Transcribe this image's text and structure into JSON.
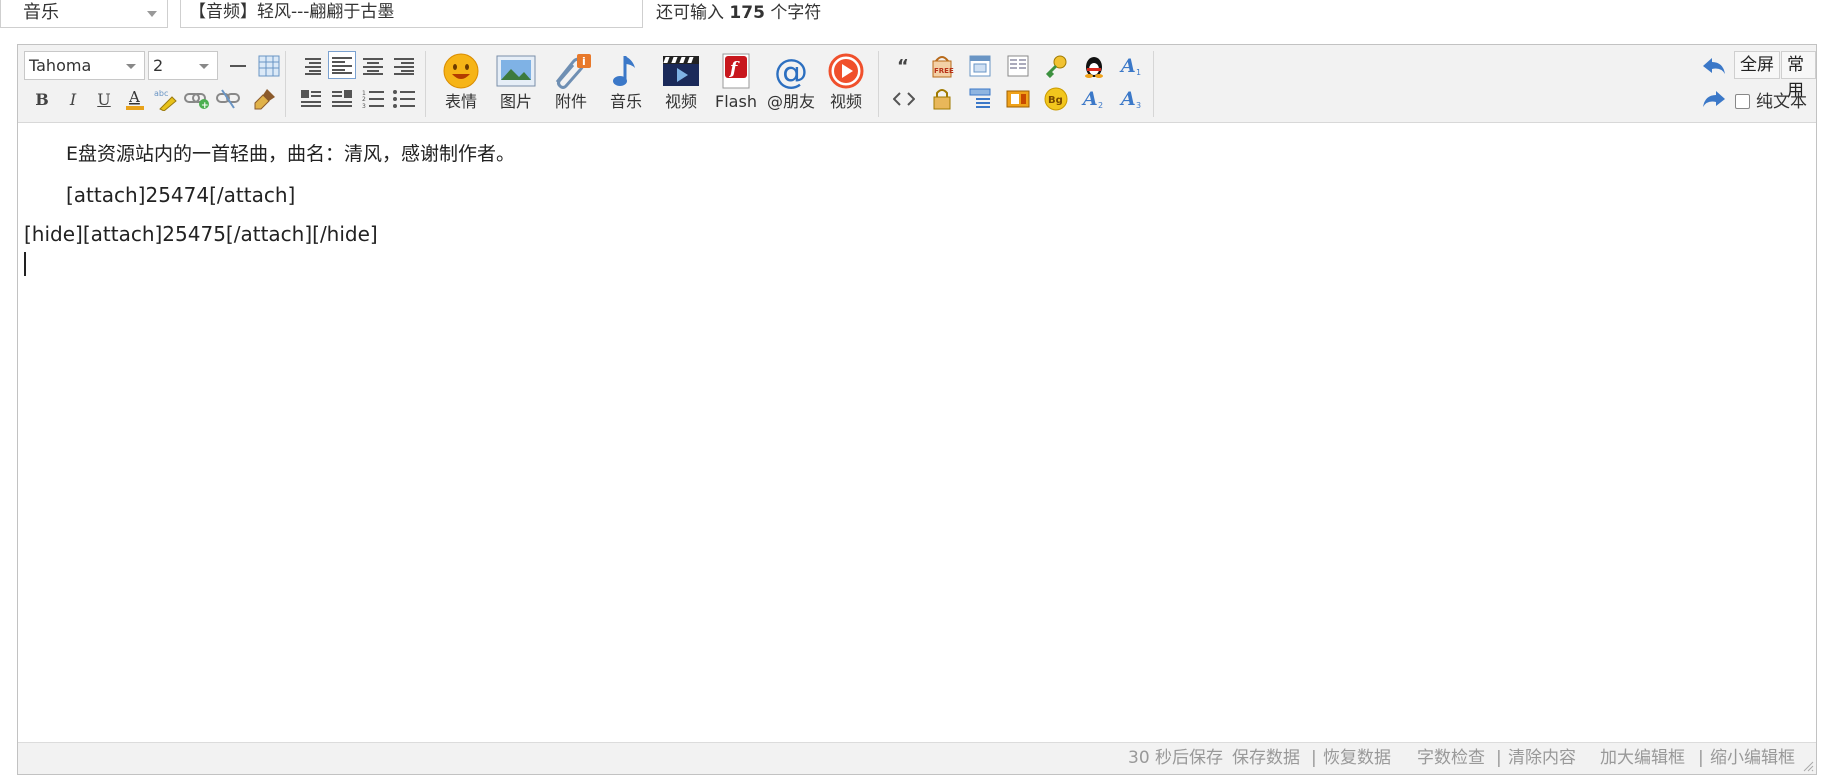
{
  "top": {
    "category_value": "音乐",
    "title_value": "【音频】轻风---翩翩于古墨",
    "remaining_prefix": "还可输入",
    "remaining_count": "175",
    "remaining_suffix": "个字符"
  },
  "toolbar": {
    "font_family": "Tahoma",
    "font_size": "2",
    "bold_label": "B",
    "italic_label": "I",
    "underline_label": "U",
    "font_color_label": "A",
    "big_buttons": [
      {
        "label": "表情",
        "icon": "smiley-icon"
      },
      {
        "label": "图片",
        "icon": "image-icon"
      },
      {
        "label": "附件",
        "icon": "attachment-icon"
      },
      {
        "label": "音乐",
        "icon": "music-icon"
      },
      {
        "label": "视频",
        "icon": "video-clapper-icon"
      },
      {
        "label": "Flash",
        "icon": "flash-icon"
      },
      {
        "label": "@朋友",
        "icon": "at-icon"
      },
      {
        "label": "视频",
        "icon": "play-circle-icon"
      }
    ],
    "fullscreen_label": "全屏",
    "common_label": "常用",
    "plain_text_label": "纯文本"
  },
  "content": {
    "line1": "E盘资源站内的一首轻曲，曲名：清风，感谢制作者。",
    "line2": "[attach]25474[/attach]",
    "line3": "[hide][attach]25475[/attach][/hide]"
  },
  "footer": {
    "autosave": "30 秒后保存",
    "save_data": "保存数据",
    "sep1": "|",
    "restore_data": "恢复数据",
    "word_check": "字数检查",
    "sep2": "|",
    "clear_content": "清除内容",
    "enlarge": "加大编辑框",
    "sep3": "|",
    "shrink": "缩小编辑框"
  },
  "colors": {
    "toolbar_bg": "#f2f2f2",
    "border": "#c2c2c2",
    "accent_blue": "#3b78c8",
    "footer_text": "#999999"
  }
}
